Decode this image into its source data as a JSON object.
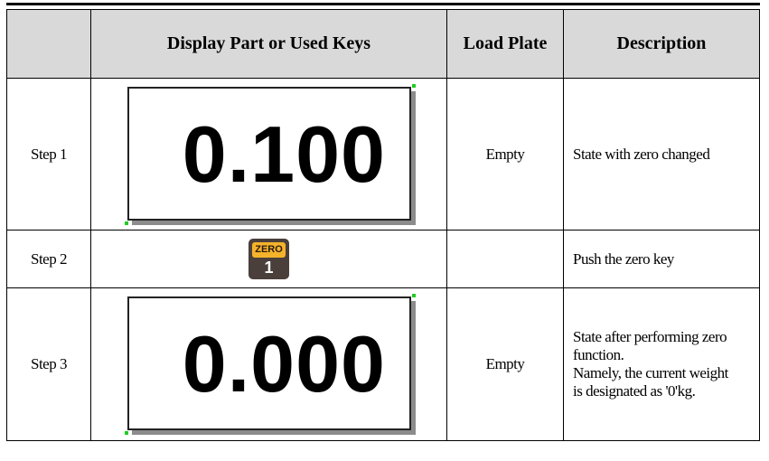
{
  "table": {
    "headers": [
      "",
      "Display Part or Used Keys",
      "Load Plate",
      "Description"
    ],
    "rows": [
      {
        "step": "Step 1",
        "display_value": "0.100",
        "load_plate": "Empty",
        "description": [
          "State with zero changed"
        ]
      },
      {
        "step": "Step 2",
        "key": {
          "label": "ZERO",
          "number": "1"
        },
        "load_plate": "",
        "description": [
          "Push the zero key"
        ]
      },
      {
        "step": "Step 3",
        "display_value": "0.000",
        "load_plate": "Empty",
        "description": [
          "State after performing zero",
          "function.",
          "Namely, the current weight",
          "is designated as '0'kg."
        ]
      }
    ]
  },
  "colors": {
    "header_bg": "#d9d9d9",
    "key_body": "#4a3f3b",
    "key_label_bg": "#f5b32a",
    "corner_marker": "#22cc22"
  },
  "icons": {
    "zero_key": "zero-key-icon"
  }
}
